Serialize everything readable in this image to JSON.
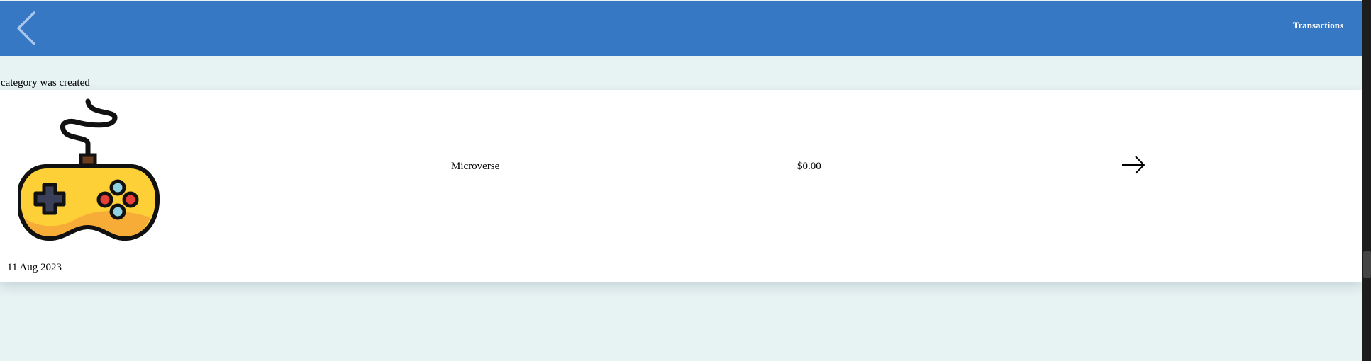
{
  "header": {
    "title_link": "Transactions",
    "back_icon": "chevron-left-icon",
    "background_color": "#3778c4"
  },
  "notice": {
    "text": "category was created"
  },
  "category": {
    "icon": "gamepad-icon",
    "name": "Microverse",
    "amount": "$0.00",
    "date": "11 Aug 2023",
    "open_icon": "arrow-right-icon"
  },
  "colors": {
    "page_background": "#e7f2f2",
    "card_background": "#ffffff",
    "gamepad_body": "#fdd038",
    "gamepad_shadow": "#f7a738"
  }
}
